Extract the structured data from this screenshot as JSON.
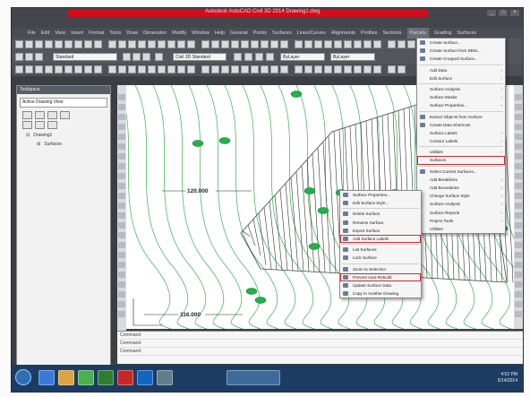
{
  "window": {
    "title": "Autodesk AutoCAD Civil 3D 2014   Drawing1.dwg",
    "buttons": [
      "_",
      "□",
      "×"
    ]
  },
  "menubar": {
    "items": [
      "File",
      "Edit",
      "View",
      "Insert",
      "Format",
      "Tools",
      "Draw",
      "Dimension",
      "Modify",
      "Window",
      "Help",
      "General",
      "Points",
      "Surfaces",
      "Lines/Curves",
      "Alignments",
      "Profiles",
      "Sections",
      "Parcels",
      "Grading",
      "Surfaces"
    ],
    "active_index": 18
  },
  "toolbar": {
    "layer_dropdown": "Standard",
    "style_dropdown": "Civil 3D Standard",
    "annotation_dropdown": "ByLayer",
    "linetype_dropdown": "ByLayer"
  },
  "toolspace": {
    "title": "Toolspace",
    "view_select": "Active Drawing View",
    "tree": [
      "Drawing1",
      "Surfaces"
    ]
  },
  "drawing": {
    "contour_labels": [
      "120.000",
      "116.000"
    ]
  },
  "command_lines": [
    "Command:",
    "Command:",
    "Command:"
  ],
  "surfaces_menu": {
    "items": [
      {
        "label": "Create Surface...",
        "icon": "surface-icon",
        "submenu": false
      },
      {
        "label": "Create Surface from DEM...",
        "icon": "dem-icon",
        "submenu": false
      },
      {
        "label": "Create Cropped Surface...",
        "icon": "crop-icon",
        "submenu": false
      },
      {
        "sep": true
      },
      {
        "label": "Add Data",
        "icon": "",
        "submenu": true
      },
      {
        "label": "Edit Surface",
        "icon": "",
        "submenu": true
      },
      {
        "sep": true
      },
      {
        "label": "Surface Analysis",
        "icon": "",
        "submenu": true
      },
      {
        "label": "Surface Masks",
        "icon": "",
        "submenu": true
      },
      {
        "label": "Surface Properties...",
        "icon": "",
        "submenu": true
      },
      {
        "sep": true
      },
      {
        "label": "Extract Objects from Surface",
        "icon": "extract-icon",
        "submenu": false
      },
      {
        "label": "Create Data Shortcuts",
        "icon": "shortcut-icon",
        "submenu": false
      },
      {
        "label": "Surface Labels",
        "icon": "",
        "submenu": true
      },
      {
        "label": "Contour Labels",
        "icon": "",
        "submenu": true
      },
      {
        "sep": true
      },
      {
        "label": "Utilities",
        "icon": "",
        "submenu": true
      },
      {
        "label": "Surfaces",
        "icon": "",
        "submenu": false,
        "highlight": true
      },
      {
        "sep": true
      },
      {
        "label": "Select Current Surfaces...",
        "icon": "select-icon",
        "submenu": false
      },
      {
        "label": "Add Breaklines",
        "icon": "",
        "submenu": true
      },
      {
        "label": "Add Boundaries",
        "icon": "",
        "submenu": true
      },
      {
        "label": "Change Surface Style",
        "icon": "",
        "submenu": true
      },
      {
        "label": "Surface Analysis",
        "icon": "",
        "submenu": true
      },
      {
        "label": "Surface Reports",
        "icon": "",
        "submenu": true
      },
      {
        "label": "Project Tools",
        "icon": "",
        "submenu": true
      },
      {
        "label": "Utilities",
        "icon": "",
        "submenu": false
      }
    ]
  },
  "context_menu": {
    "items": [
      {
        "label": "Surface Properties...",
        "icon": "props-icon"
      },
      {
        "label": "Edit Surface Style...",
        "icon": "style-icon"
      },
      {
        "sep": true
      },
      {
        "label": "Delete Surface",
        "icon": "delete-icon"
      },
      {
        "label": "Rename Surface",
        "icon": "rename-icon"
      },
      {
        "label": "Export Surface",
        "icon": "export-icon"
      },
      {
        "label": "Add Surface Labels",
        "icon": "label-icon",
        "highlight": true
      },
      {
        "sep": true
      },
      {
        "label": "List Surfaces",
        "icon": "list-icon"
      },
      {
        "label": "Lock Surface",
        "icon": "lock-icon"
      },
      {
        "sep": true
      },
      {
        "label": "Zoom to Selection",
        "icon": "zoom-icon"
      },
      {
        "label": "Prevent Auto-Rebuild",
        "icon": "rebuild-icon",
        "highlight": true
      },
      {
        "label": "Update Surface Data",
        "icon": "update-icon"
      },
      {
        "label": "Copy to Another Drawing",
        "icon": "copy-icon"
      }
    ]
  },
  "taskbar": {
    "time": "4:52 PM",
    "date": "5/14/2014"
  },
  "colors": {
    "title_red": "#d40c1d",
    "contour_green": "#22b14c",
    "hatch": "#333333",
    "highlight": "#d8262f"
  }
}
